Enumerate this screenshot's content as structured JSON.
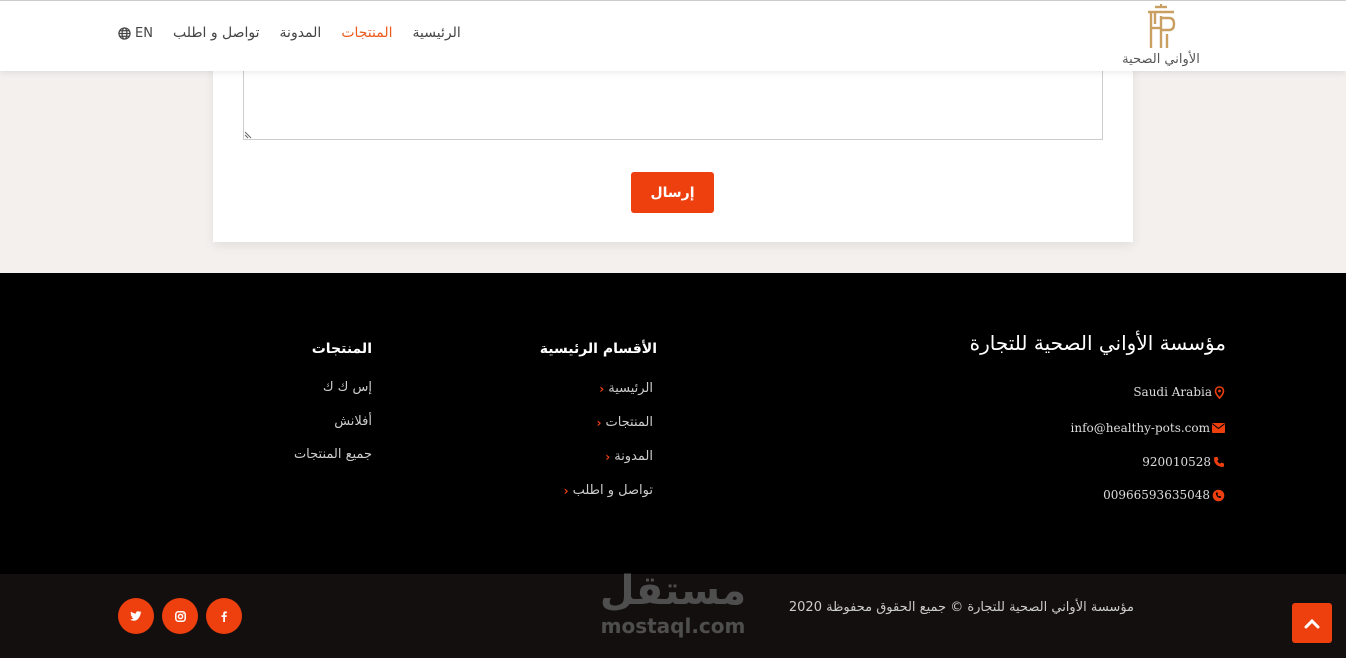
{
  "header": {
    "logo_text": "الأواني الصحية",
    "nav": [
      "الرئيسية",
      "المنتجات",
      "المدونة",
      "تواصل و اطلب"
    ],
    "active_index": 1,
    "lang_label": "EN"
  },
  "form": {
    "submit_label": "إرسال"
  },
  "footer": {
    "company_title": "مؤسسة الأواني الصحية للتجارة",
    "contact": {
      "location": "Saudi Arabia",
      "email": "info@healthy-pots.com",
      "phone": "920010528",
      "whatsapp": "00966593635048"
    },
    "sections_title": "الأقسام الرئيسية",
    "sections": [
      "الرئيسية",
      "المنتجات",
      "المدونة",
      "تواصل و اطلب"
    ],
    "products_title": "المنتجات",
    "products": [
      "إس ك ك",
      "أفلانش",
      "جميع المنتجات"
    ]
  },
  "bottom": {
    "copyright": "مؤسسة الأواني الصحية للتجارة © جميع الحقوق محفوظة 2020",
    "watermark_ar": "مستقل",
    "watermark_en": "mostaql.com",
    "social": [
      "twitter-icon",
      "instagram-icon",
      "facebook-icon"
    ]
  },
  "colors": {
    "accent": "#ee3f0e",
    "active_nav": "#ec5b1c",
    "footer_bg": "#000000",
    "bottom_bg": "#130f0e",
    "logo_gold": "#c9a062"
  }
}
